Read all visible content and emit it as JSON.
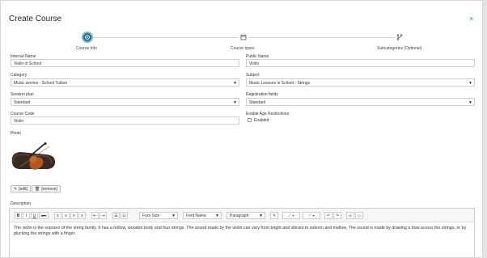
{
  "header": {
    "title": "Create Course",
    "close": "×"
  },
  "steps": [
    {
      "label": "Course Info"
    },
    {
      "label": "Course types"
    },
    {
      "label": "Subcategories (Optional)"
    }
  ],
  "form": {
    "internal_name": {
      "label": "Internal Name",
      "value": "Violin in School"
    },
    "public_name": {
      "label": "Public Name",
      "value": "Violin"
    },
    "category": {
      "label": "Category",
      "value": "Music service - School Tuition"
    },
    "subject": {
      "label": "Subject",
      "value": "Music Lessons in School - Strings"
    },
    "session_plan": {
      "label": "Session plan",
      "value": "Standard"
    },
    "registration_fields": {
      "label": "Registration fields",
      "value": "Standard"
    },
    "course_code": {
      "label": "Course Code",
      "value": "Violin"
    },
    "age_restrictions": {
      "label": "Enable Age Restrictions",
      "checkbox_label": "Enabled"
    }
  },
  "photo": {
    "label": "Photo",
    "edit_label": "[edit]",
    "remove_label": "[remove]"
  },
  "description": {
    "label": "Description",
    "toolbar": {
      "bold": "B",
      "italic": "I",
      "underline": "U",
      "strike": "abc",
      "font_size": "Font Size",
      "font_name": "Font Name",
      "format": "Paragraph"
    },
    "text": "The violin is the soprano of the string family. It has a hollow, wooden body and four strings. The sound made by the violin can vary from bright and vibrant to solemn and mellow. The sound is made by drawing a bow across the strings, or by plucking the strings with a finger."
  },
  "colors": {
    "accent": "#1d6f91",
    "close": "#2a8a8f"
  }
}
